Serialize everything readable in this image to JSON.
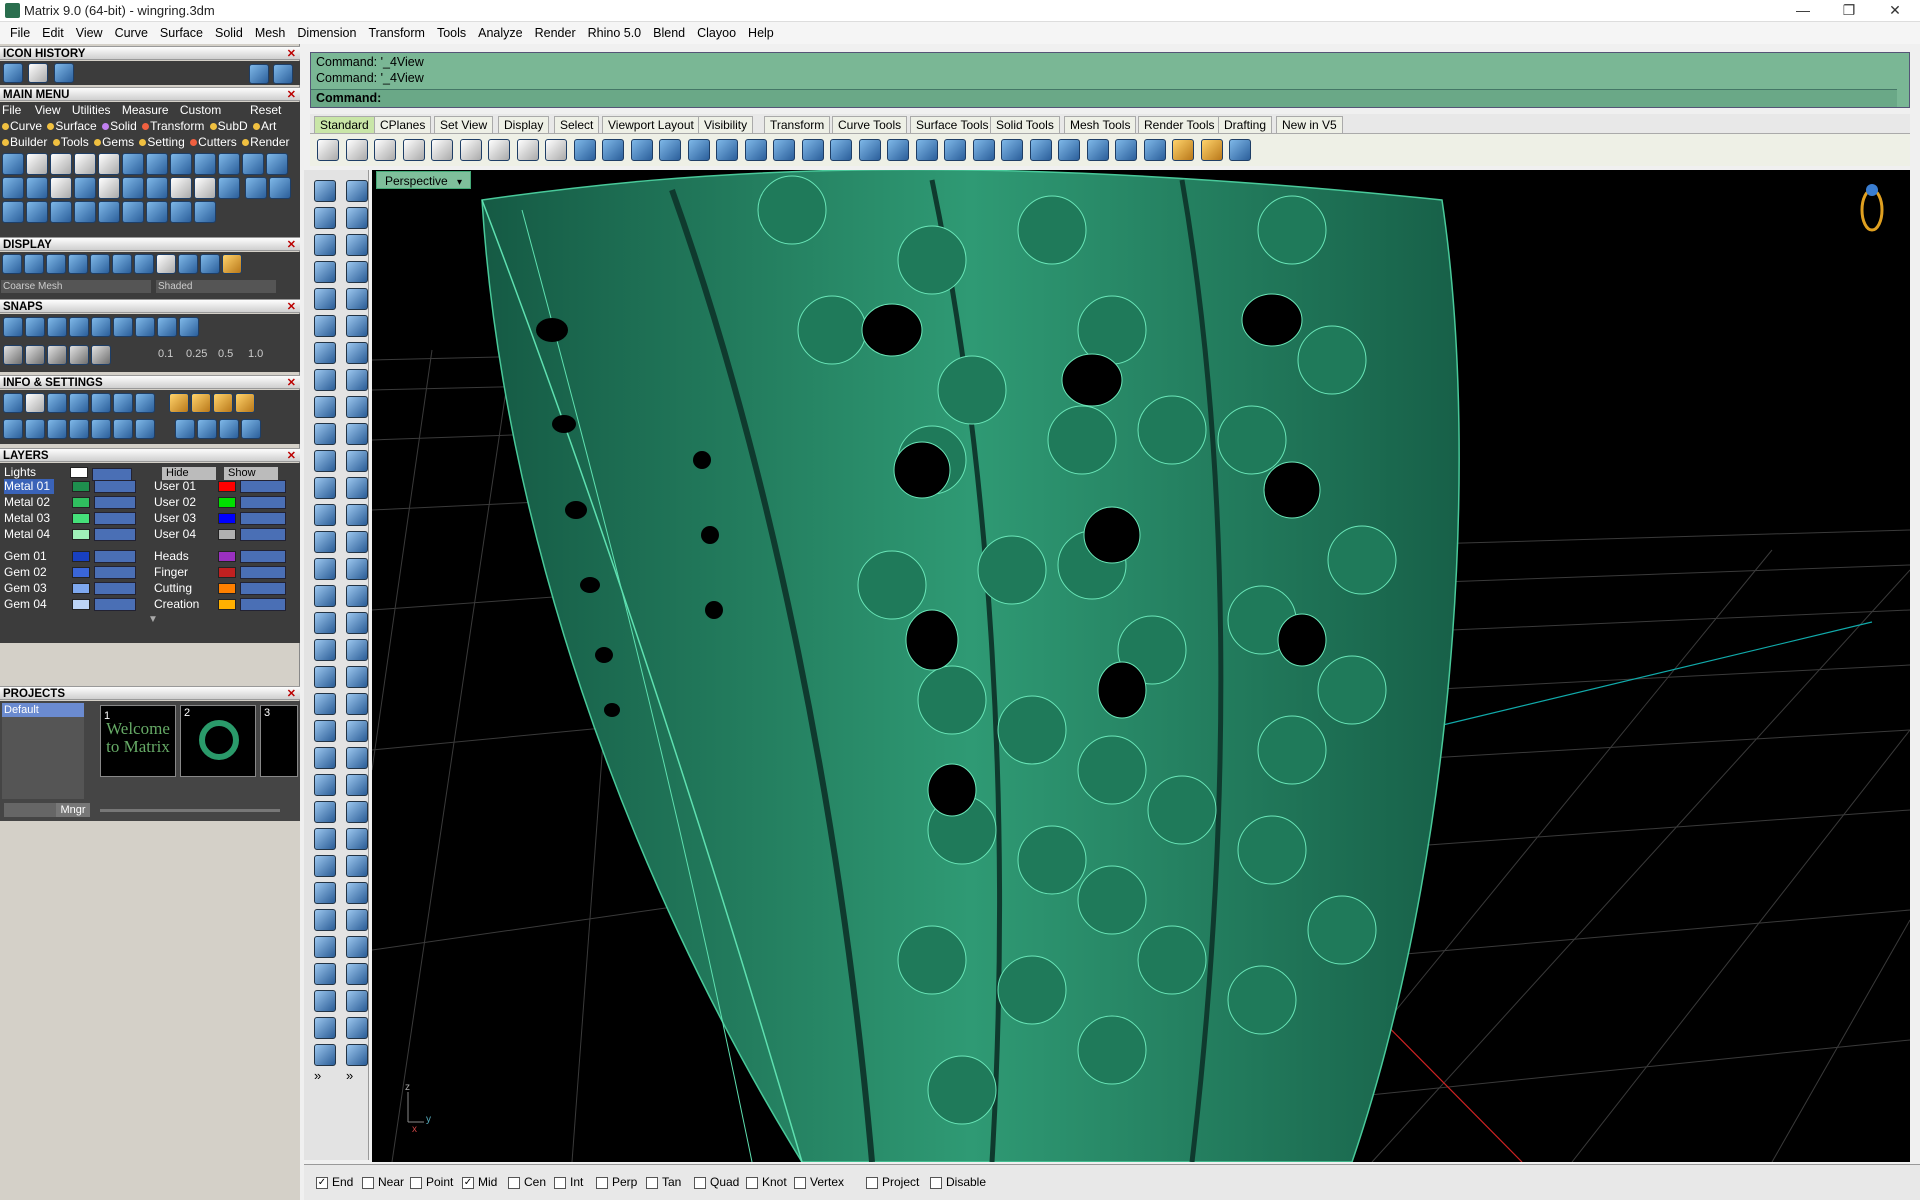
{
  "window": {
    "title": "Matrix 9.0 (64-bit) - wingring.3dm",
    "min": "—",
    "max": "❐",
    "close": "✕"
  },
  "menu": [
    "File",
    "Edit",
    "View",
    "Curve",
    "Surface",
    "Solid",
    "Mesh",
    "Dimension",
    "Transform",
    "Tools",
    "Analyze",
    "Render",
    "Rhino 5.0",
    "Blend",
    "Clayoo",
    "Help"
  ],
  "panels": {
    "icon_history": "ICON HISTORY",
    "main_menu": "MAIN MENU",
    "display": "DISPLAY",
    "snaps": "SNAPS",
    "info_settings": "INFO & SETTINGS",
    "layers": "LAYERS",
    "projects": "PROJECTS",
    "close_glyph": "✕"
  },
  "main_menu": {
    "row1": [
      "File",
      "View",
      "Utilities",
      "Measure",
      "Custom"
    ],
    "reset": "Reset",
    "row2": [
      {
        "label": "Curve",
        "color": "#f0c040"
      },
      {
        "label": "Surface",
        "color": "#f0c040"
      },
      {
        "label": "Solid",
        "color": "#c080f0"
      },
      {
        "label": "Transform",
        "color": "#f06040"
      },
      {
        "label": "SubD",
        "color": "#f0c040"
      },
      {
        "label": "Art",
        "color": "#f0c040"
      }
    ],
    "row3": [
      {
        "label": "Builder",
        "color": "#f0c040"
      },
      {
        "label": "Tools",
        "color": "#f0c040"
      },
      {
        "label": "Gems",
        "color": "#f0c040"
      },
      {
        "label": "Setting",
        "color": "#f0c040"
      },
      {
        "label": "Cutters",
        "color": "#f06040"
      },
      {
        "label": "Render",
        "color": "#f0c040"
      }
    ]
  },
  "display": {
    "mesh_select": "Coarse Mesh",
    "shade_select": "Shaded"
  },
  "snaps": {
    "values": [
      "0.1",
      "0.25",
      "0.5",
      "1.0"
    ]
  },
  "layers": {
    "lights": "Lights",
    "hide": "Hide",
    "show": "Show",
    "left": [
      {
        "name": "Metal 01",
        "color": "#1e8f4e",
        "selected": true
      },
      {
        "name": "Metal 02",
        "color": "#2fbf5f",
        "selected": false
      },
      {
        "name": "Metal 03",
        "color": "#45e07a",
        "selected": false
      },
      {
        "name": "Metal 04",
        "color": "#9ff0b8",
        "selected": false
      },
      {
        "name": "Gem 01",
        "color": "#1840c0",
        "selected": false
      },
      {
        "name": "Gem 02",
        "color": "#3a66d8",
        "selected": false
      },
      {
        "name": "Gem 03",
        "color": "#7ea8ee",
        "selected": false
      },
      {
        "name": "Gem 04",
        "color": "#bcd4f6",
        "selected": false
      }
    ],
    "right": [
      {
        "name": "User 01",
        "color": "#ff0000"
      },
      {
        "name": "User 02",
        "color": "#00e000"
      },
      {
        "name": "User 03",
        "color": "#0000ff"
      },
      {
        "name": "User 04",
        "color": "#b0b0b0"
      },
      {
        "name": "Heads",
        "color": "#9a30c0"
      },
      {
        "name": "Finger",
        "color": "#c02020"
      },
      {
        "name": "Cutting",
        "color": "#ff8000"
      },
      {
        "name": "Creation",
        "color": "#ffb000"
      }
    ]
  },
  "projects": {
    "default": "Default",
    "thumbs": [
      {
        "num": "1",
        "text": "Welcome to Matrix"
      },
      {
        "num": "2",
        "text": ""
      },
      {
        "num": "3",
        "text": ""
      }
    ],
    "mngr": "Mngr"
  },
  "command": {
    "history": [
      "Command: '_4View",
      "Command: '_4View"
    ],
    "prompt": "Command:"
  },
  "tabs": [
    "Standard",
    "CPlanes",
    "Set View",
    "Display",
    "Select",
    "Viewport Layout",
    "Visibility",
    "Transform",
    "Curve Tools",
    "Surface Tools",
    "Solid Tools",
    "Mesh Tools",
    "Render Tools",
    "Drafting",
    "New in V5"
  ],
  "viewport": {
    "label": "Perspective",
    "dropdown": "▾",
    "axis_z": "z",
    "axis_y": "y",
    "axis_x": "x",
    "more1": "»",
    "more2": "»"
  },
  "osnaps": [
    {
      "label": "End",
      "checked": true
    },
    {
      "label": "Near",
      "checked": false
    },
    {
      "label": "Point",
      "checked": false
    },
    {
      "label": "Mid",
      "checked": true
    },
    {
      "label": "Cen",
      "checked": false
    },
    {
      "label": "Int",
      "checked": false
    },
    {
      "label": "Perp",
      "checked": false
    },
    {
      "label": "Tan",
      "checked": false
    },
    {
      "label": "Quad",
      "checked": false
    },
    {
      "label": "Knot",
      "checked": false
    },
    {
      "label": "Vertex",
      "checked": false
    },
    {
      "label": "Project",
      "checked": false
    },
    {
      "label": "Disable",
      "checked": false
    }
  ],
  "colors": {
    "command_bg": "#7ab795",
    "ring_green": "#2a8a6a",
    "tab_active": "#c9e6a7"
  }
}
